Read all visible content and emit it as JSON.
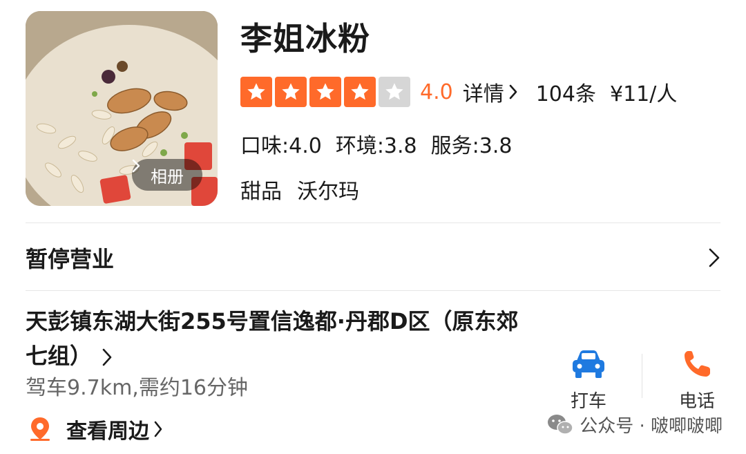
{
  "shop": {
    "name": "李姐冰粉",
    "album_label": "相册",
    "rating": 4.0,
    "rating_text": "4.0",
    "stars_filled": 4,
    "stars_total": 5,
    "detail_label": "详情",
    "review_count": "104条",
    "price_per_person": "¥11/人",
    "sub_scores": [
      "口味:4.0",
      "环境:3.8",
      "服务:3.8"
    ],
    "tags": [
      "甜品",
      "沃尔玛"
    ]
  },
  "status": {
    "text": "暂停营业"
  },
  "location": {
    "address": "天彭镇东湖大街255号置信逸都·丹郡D区（原东郊七组）",
    "drive_info": "驾车9.7km,需约16分钟",
    "nearby_label": "查看周边"
  },
  "actions": {
    "taxi_label": "打车",
    "call_label": "电话"
  },
  "watermark": {
    "text": "公众号 · 啵唧啵唧"
  },
  "colors": {
    "accent": "#ff6a2a",
    "taxi_blue": "#1f7ae0",
    "star_off": "#d6d6d6",
    "muted_text": "#666666"
  },
  "icons": {
    "star": "star-icon",
    "chevron": "chevron-right-icon",
    "car": "car-icon",
    "phone": "phone-icon",
    "location": "location-pin-icon",
    "wechat": "wechat-icon"
  }
}
